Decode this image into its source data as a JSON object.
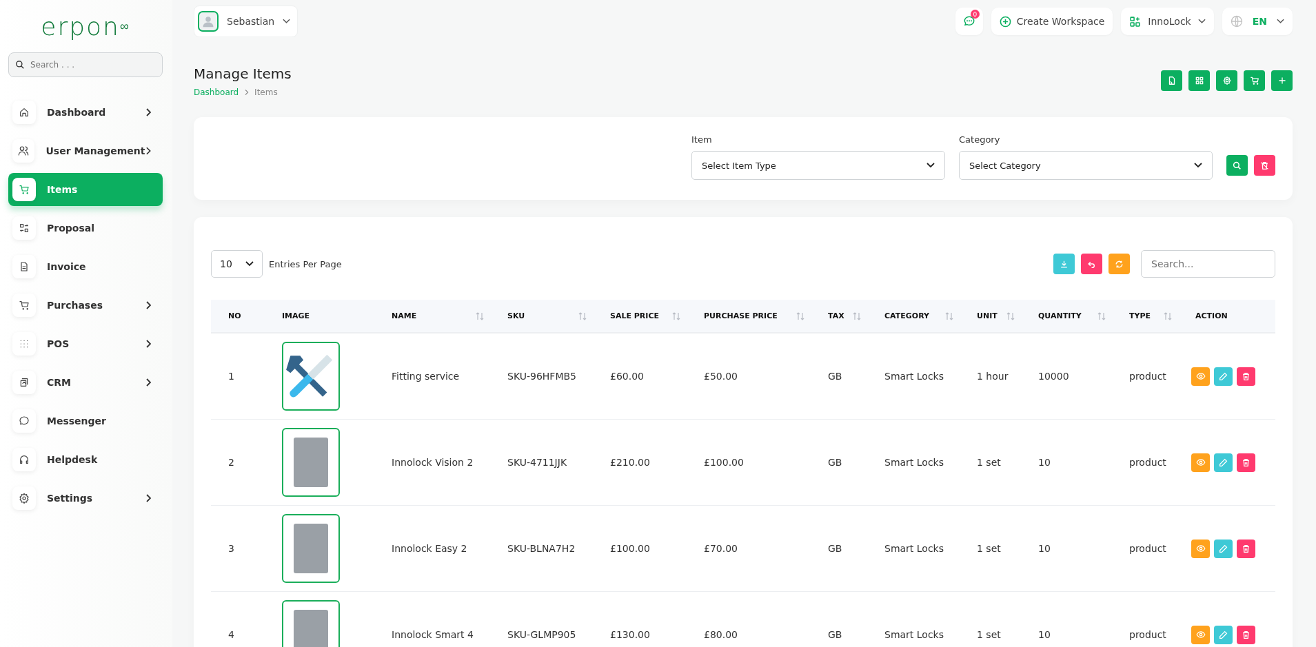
{
  "logo": "erpon$^{∞}$",
  "sidebar": {
    "search": {
      "placeholder": "Search . . ."
    },
    "items": [
      {
        "label": "Dashboard",
        "selected": false,
        "expandable": true
      },
      {
        "label": "User Management",
        "selected": false,
        "expandable": true
      },
      {
        "label": "Items",
        "selected": true,
        "expandable": false
      },
      {
        "label": "Proposal",
        "selected": false,
        "expandable": false
      },
      {
        "label": "Invoice",
        "selected": false,
        "expandable": false
      },
      {
        "label": "Purchases",
        "selected": false,
        "expandable": true
      },
      {
        "label": "POS",
        "selected": false,
        "expandable": true
      },
      {
        "label": "CRM",
        "selected": false,
        "expandable": true
      },
      {
        "label": "Messenger",
        "selected": false,
        "expandable": false
      },
      {
        "label": "Helpdesk",
        "selected": false,
        "expandable": false
      },
      {
        "label": "Settings",
        "selected": false,
        "expandable": true
      }
    ]
  },
  "topbar": {
    "user": "Sebastian",
    "messages_badge": "0",
    "create_workspace": "Create Workspace",
    "workspace": "InnoLock",
    "language": "EN"
  },
  "page": {
    "title": "Manage Items",
    "breadcrumb": [
      "Dashboard",
      "Items"
    ]
  },
  "filters": [
    {
      "label": "Item",
      "placeholder": "Select Item Type"
    },
    {
      "label": "Category",
      "placeholder": "Select Category"
    }
  ],
  "table": {
    "entries": "10",
    "entries_label": "Entries Per Page",
    "search": {
      "placeholder": "Search..."
    },
    "columns": [
      {
        "label": "NO",
        "sortable": false
      },
      {
        "label": "IMAGE",
        "sortable": false
      },
      {
        "label": "NAME",
        "sortable": true
      },
      {
        "label": "SKU",
        "sortable": true
      },
      {
        "label": "SALE PRICE",
        "sortable": true
      },
      {
        "label": "PURCHASE PRICE",
        "sortable": true
      },
      {
        "label": "TAX",
        "sortable": true
      },
      {
        "label": "CATEGORY",
        "sortable": true
      },
      {
        "label": "UNIT",
        "sortable": true
      },
      {
        "label": "QUANTITY",
        "sortable": true
      },
      {
        "label": "TYPE",
        "sortable": true
      },
      {
        "label": "ACTION",
        "sortable": false
      }
    ],
    "rows": [
      {
        "kind": "tools",
        "cells": [
          "1",
          "",
          "Fitting service",
          "SKU-96HFMB5",
          "£60.00",
          "£50.00",
          "GB",
          "Smart Locks",
          "1 hour",
          "10000",
          "product"
        ]
      },
      {
        "kind": "photo",
        "cells": [
          "2",
          "",
          "Innolock Vision 2",
          "SKU-4711JJK",
          "£210.00",
          "£100.00",
          "GB",
          "Smart Locks",
          "1 set",
          "10",
          "product"
        ]
      },
      {
        "kind": "photo",
        "cells": [
          "3",
          "",
          "Innolock Easy 2",
          "SKU-BLNA7H2",
          "£100.00",
          "£70.00",
          "GB",
          "Smart Locks",
          "1 set",
          "10",
          "product"
        ]
      },
      {
        "kind": "photo",
        "cells": [
          "4",
          "",
          "Innolock Smart 4",
          "SKU-GLMP905",
          "£130.00",
          "£80.00",
          "GB",
          "Smart Locks",
          "1 set",
          "10",
          "product"
        ]
      }
    ]
  }
}
